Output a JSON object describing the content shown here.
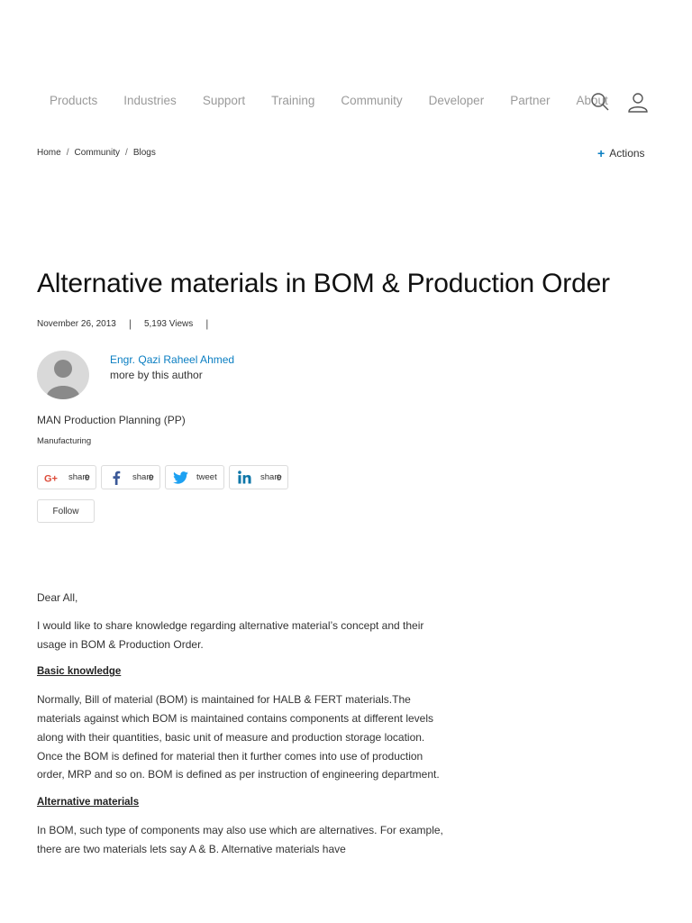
{
  "nav": {
    "items": [
      "Products",
      "Industries",
      "Support",
      "Training",
      "Community",
      "Developer",
      "Partner",
      "About"
    ],
    "icons": [
      "search-icon",
      "user-icon"
    ]
  },
  "breadcrumb": [
    "Home",
    "Community",
    "Blogs"
  ],
  "breadcrumb_sep": "/",
  "actions_label": "Actions",
  "article": {
    "title": "Alternative materials in BOM & Production Order",
    "date": "November 26, 2013",
    "views": "5,193 Views",
    "author_name": "Engr. Qazi Raheel Ahmed",
    "author_more": "more by this author",
    "tag_primary": "MAN Production Planning (PP)",
    "tag_secondary": "Manufacturing"
  },
  "share": [
    {
      "network": "google-plus",
      "label": "share",
      "count": "0"
    },
    {
      "network": "facebook",
      "label": "share",
      "count": "0"
    },
    {
      "network": "twitter",
      "label": "tweet",
      "count": ""
    },
    {
      "network": "linkedin",
      "label": "share",
      "count": "0"
    }
  ],
  "follow_label": "Follow",
  "body": {
    "greeting": "Dear All,",
    "intro": "I would like to share knowledge regarding alternative material’s concept and their usage in BOM & Production Order.",
    "heading1": "Basic knowledge",
    "para1": "Normally, Bill of material (BOM) is maintained for HALB & FERT materials.The materials against which BOM is maintained contains components at different levels along with their quantities, basic unit of measure and production storage location. Once the BOM is defined for material then it further comes into use of production order, MRP and so on. BOM is defined as per instruction of engineering department.",
    "heading2": "Alternative materials",
    "para2": "In BOM, such type of components may also use which are alternatives. For example, there are two materials lets say A & B. Alternative materials have"
  },
  "colors": {
    "link": "#0a7ec2",
    "google": "#dd4b39",
    "facebook": "#3b5998",
    "twitter": "#1da1f2",
    "linkedin": "#0e76a8"
  }
}
